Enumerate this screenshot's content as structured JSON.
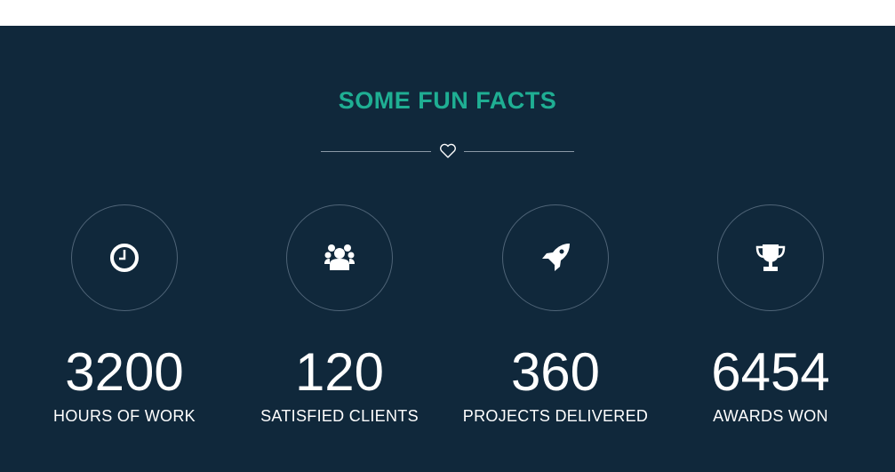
{
  "section": {
    "title": "SOME FUN FACTS",
    "divider_icon": "heart-outline-icon",
    "accent_color": "#1fae93",
    "background_color": "#10283b"
  },
  "stats": [
    {
      "icon": "clock-icon",
      "value": "3200",
      "label": "HOURS OF WORK"
    },
    {
      "icon": "users-group-icon",
      "value": "120",
      "label": "SATISFIED CLIENTS"
    },
    {
      "icon": "rocket-icon",
      "value": "360",
      "label": "PROJECTS DELIVERED"
    },
    {
      "icon": "trophy-icon",
      "value": "6454",
      "label": "AWARDS WON"
    }
  ]
}
